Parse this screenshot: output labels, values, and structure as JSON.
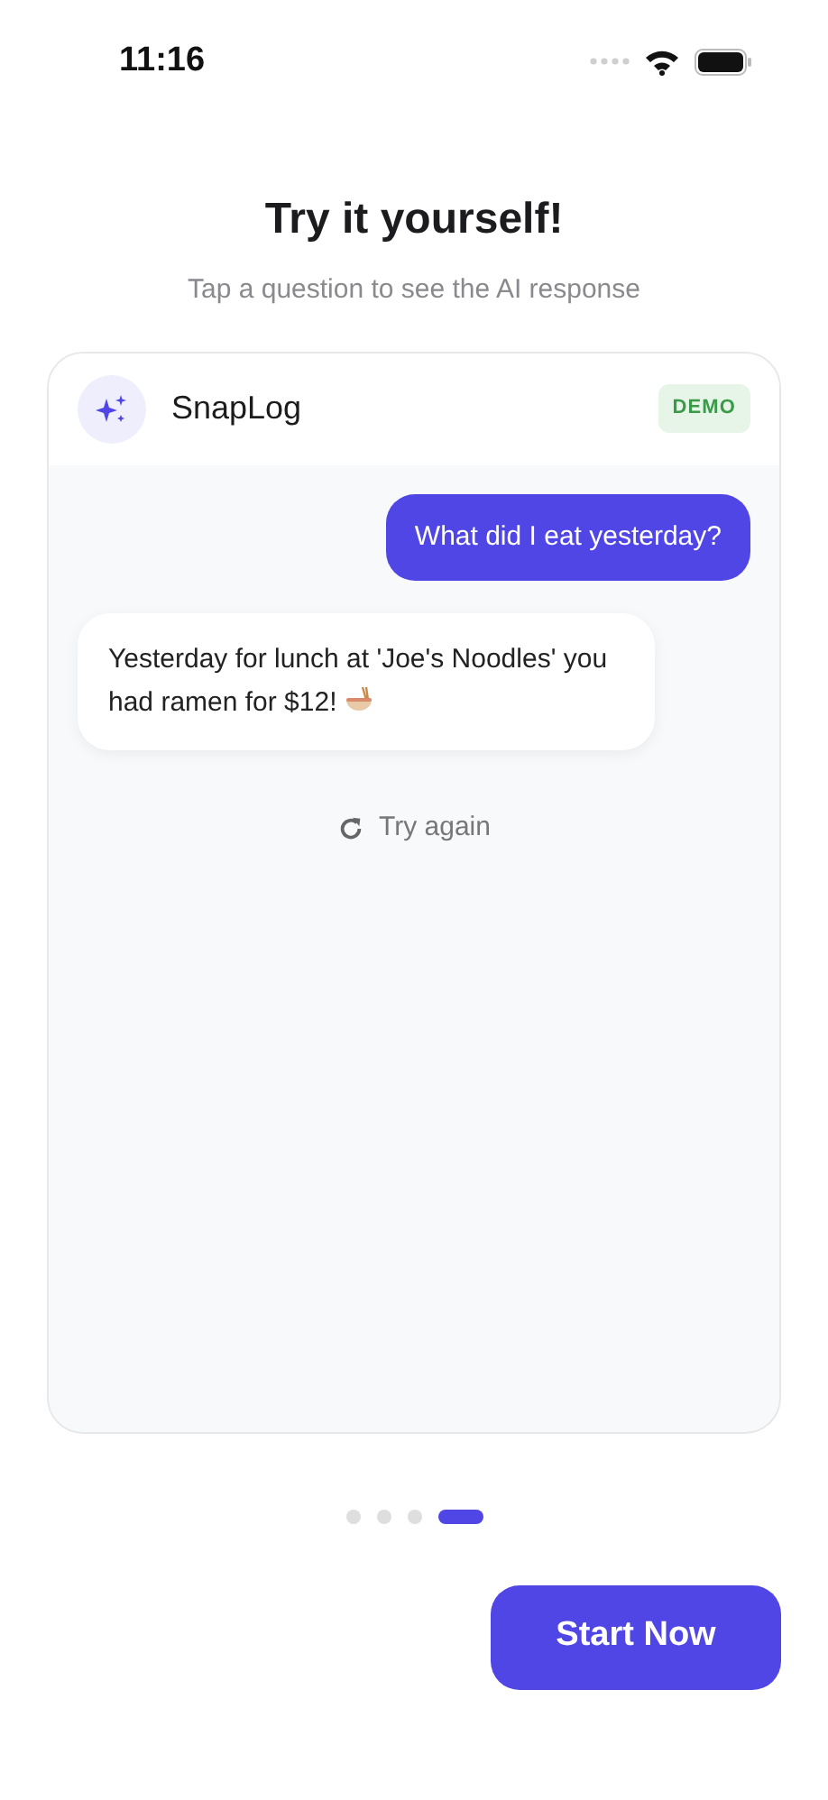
{
  "status_bar": {
    "time": "11:16"
  },
  "title": "Try it yourself!",
  "subtitle": "Tap a question to see the AI response",
  "chat": {
    "app_name": "SnapLog",
    "badge": "DEMO",
    "messages": [
      {
        "kind": "user",
        "text": "What did I eat yesterday?"
      },
      {
        "kind": "assistant",
        "text": "Yesterday for lunch at 'Joe's Noodles' you had ramen for $12!"
      }
    ],
    "retry": "Try again"
  },
  "pages": [
    {
      "selected": false
    },
    {
      "selected": false
    },
    {
      "selected": false
    },
    {
      "selected": true
    }
  ],
  "primary_button": "Start Now"
}
